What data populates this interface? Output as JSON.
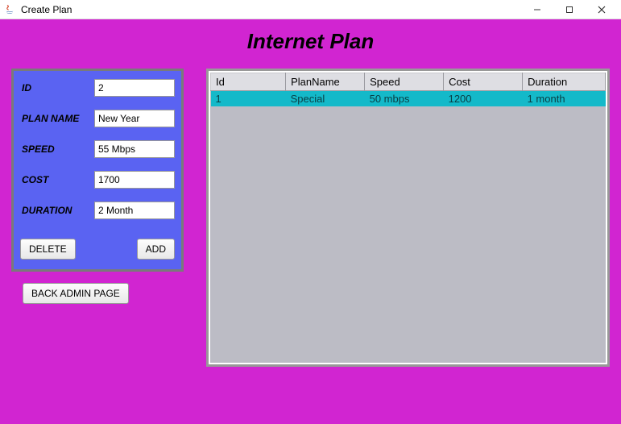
{
  "window": {
    "title": "Create Plan"
  },
  "header": {
    "title": "Internet Plan"
  },
  "form": {
    "labels": {
      "id": "ID",
      "plan_name": "PLAN NAME",
      "speed": "SPEED",
      "cost": "COST",
      "duration": "DURATION"
    },
    "values": {
      "id": "2",
      "plan_name": "New Year",
      "speed": "55 Mbps",
      "cost": "1700",
      "duration": "2 Month"
    },
    "delete_label": "DELETE",
    "add_label": "ADD"
  },
  "back_label": "BACK ADMIN PAGE",
  "table": {
    "headers": {
      "id": "Id",
      "plan_name": "PlanName",
      "speed": "Speed",
      "cost": "Cost",
      "duration": "Duration"
    },
    "rows": [
      {
        "id": "1",
        "plan_name": "Special",
        "speed": "50 mbps",
        "cost": "1200",
        "duration": "1 month"
      }
    ]
  }
}
